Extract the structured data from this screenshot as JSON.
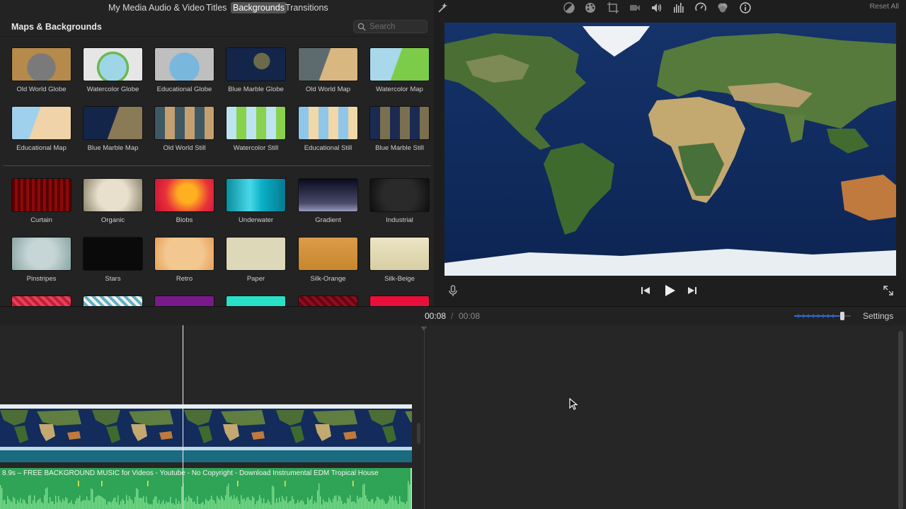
{
  "browser": {
    "tabs": [
      "My Media",
      "Audio & Video",
      "Titles",
      "Backgrounds",
      "Transitions"
    ],
    "active_tab": "Backgrounds",
    "section_title": "Maps & Backgrounds",
    "search_placeholder": "Search",
    "maps": [
      "Old World Globe",
      "Watercolor Globe",
      "Educational Globe",
      "Blue Marble Globe",
      "Old World Map",
      "Watercolor Map",
      "Educational Map",
      "Blue Marble Map",
      "Old World Still",
      "Watercolor Still",
      "Educational Still",
      "Blue Marble Still"
    ],
    "backgrounds": [
      "Curtain",
      "Organic",
      "Blobs",
      "Underwater",
      "Gradient",
      "Industrial",
      "Pinstripes",
      "Stars",
      "Retro",
      "Paper",
      "Silk-Orange",
      "Silk-Beige"
    ]
  },
  "viewer": {
    "reset_label": "Reset All",
    "toolbar_icons": [
      "magic-wand-icon",
      "color-balance-icon",
      "color-correction-icon",
      "crop-icon",
      "stabilization-icon",
      "volume-icon",
      "equalizer-icon",
      "speed-icon",
      "clip-filter-icon",
      "info-icon"
    ],
    "playback_icons": [
      "microphone-icon",
      "skip-back-icon",
      "play-icon",
      "skip-forward-icon",
      "fullscreen-icon"
    ]
  },
  "timeline": {
    "current_time": "00:08",
    "separator": "/",
    "total_duration": "00:08",
    "settings_label": "Settings",
    "zoom_level": 0.85,
    "audio_clip_title": "8.9s – FREE BACKGROUND MUSIC for Videos - Youtube - No Copyright - Download Instrumental EDM Tropical House"
  },
  "colors": {
    "audio_clip": "#2fa356",
    "active_tab": "#545454",
    "accent_blue": "#2d6fd6"
  }
}
